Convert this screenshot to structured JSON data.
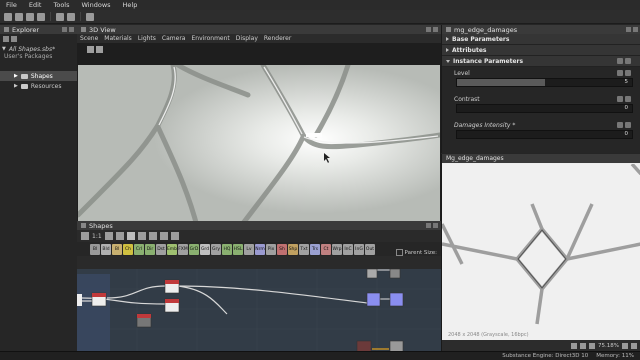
{
  "menubar": [
    "File",
    "Edit",
    "Tools",
    "Windows",
    "Help"
  ],
  "explorer": {
    "title": "Explorer",
    "package": "All Shapes.sbs*",
    "section": "User's Packages",
    "items": [
      "Shapes",
      "Resources"
    ]
  },
  "view3d": {
    "title": "3D View",
    "menu": [
      "Scene",
      "Materials",
      "Lights",
      "Camera",
      "Environment",
      "Display",
      "Renderer"
    ]
  },
  "graph": {
    "title": "Shapes",
    "zoom_label": "1:1",
    "parent_size_label": "Parent Size:",
    "atoms": [
      {
        "label": "Bl",
        "color": "#9a9a9a"
      },
      {
        "label": "Bld",
        "color": "#b0b0b0"
      },
      {
        "label": "Bl",
        "color": "#c8b070"
      },
      {
        "label": "Ch",
        "color": "#d0c040"
      },
      {
        "label": "Crl",
        "color": "#8ab070"
      },
      {
        "label": "Dir",
        "color": "#8ab070"
      },
      {
        "label": "Dst",
        "color": "#a0a0a0"
      },
      {
        "label": "Emb",
        "color": "#9fc070"
      },
      {
        "label": "FXM",
        "color": "#a0a0a0"
      },
      {
        "label": "GrD",
        "color": "#8ab070"
      },
      {
        "label": "Grd",
        "color": "#c0c0c0"
      },
      {
        "label": "Gry",
        "color": "#a0a0a0"
      },
      {
        "label": "HQ",
        "color": "#8ab070"
      },
      {
        "label": "HSL",
        "color": "#8ab070"
      },
      {
        "label": "Lv",
        "color": "#a0a0a0"
      },
      {
        "label": "Nrm",
        "color": "#9a9ad0"
      },
      {
        "label": "Pix",
        "color": "#a0a0a0"
      },
      {
        "label": "Sh",
        "color": "#c07070"
      },
      {
        "label": "Shp",
        "color": "#c0a060"
      },
      {
        "label": "Txt",
        "color": "#a0a0a0"
      },
      {
        "label": "Trs",
        "color": "#9aa0d0"
      },
      {
        "label": "Ct",
        "color": "#c08080"
      },
      {
        "label": "Wrp",
        "color": "#a0a0a0"
      },
      {
        "label": "InC",
        "color": "#a0a0a0"
      },
      {
        "label": "InG",
        "color": "#a0a0a0"
      },
      {
        "label": "Out",
        "color": "#a0a0a0"
      }
    ]
  },
  "properties": {
    "title": "mg_edge_damages",
    "sections": [
      "Base Parameters",
      "Attributes",
      "Instance Parameters"
    ],
    "params": [
      {
        "label": "Level",
        "value": "5",
        "fill": 0.5
      },
      {
        "label": "Contrast",
        "value": "0",
        "fill": 0
      },
      {
        "label": "Damages Intensity *",
        "value": "0",
        "fill": 0
      }
    ]
  },
  "view2d": {
    "title": "Mg_edge_damages",
    "resolution": "2048 x 2048 (Grayscale, 16bpc)",
    "zoom": "75.18%"
  },
  "statusbar": {
    "engine": "Substance Engine: Direct3D 10",
    "memory": "Memory: 11%"
  }
}
